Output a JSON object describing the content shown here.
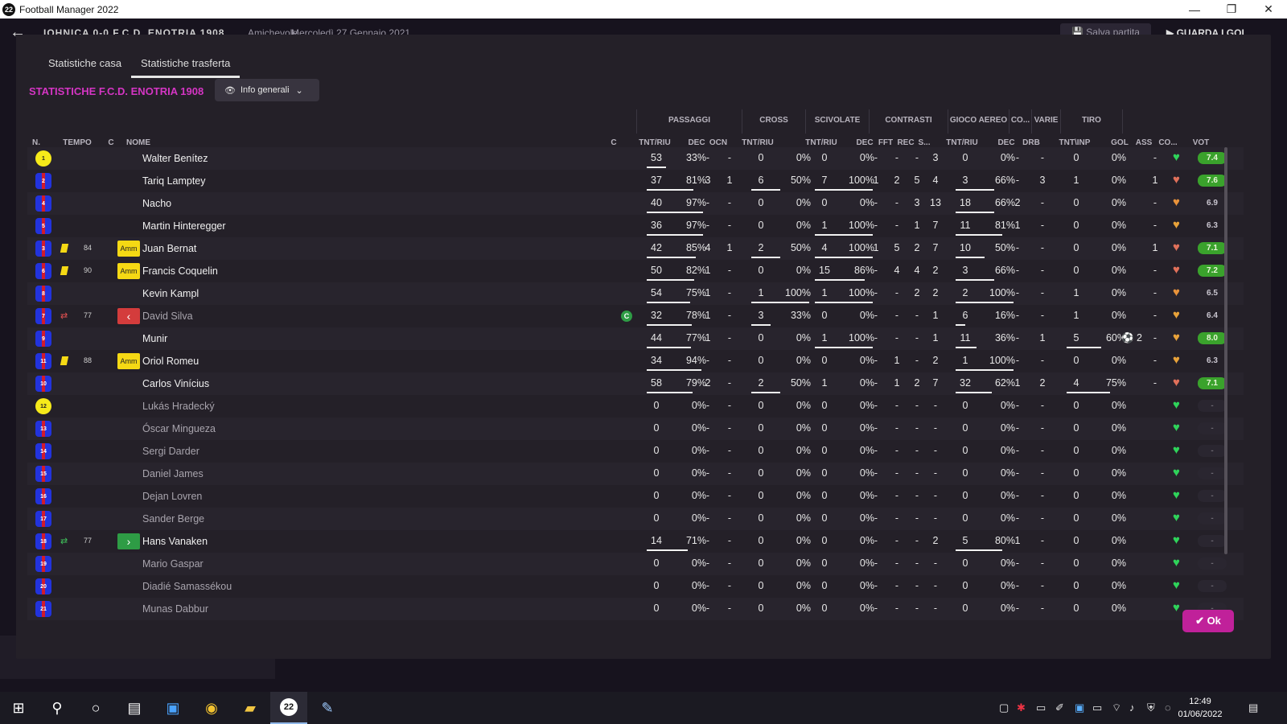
{
  "window": {
    "title": "Football Manager 2022",
    "app_icon": "22",
    "minimize": "—",
    "maximize": "❐",
    "close": "✕"
  },
  "bg_header": {
    "match_title": "IOHNICA 0-0 F.C.D. ENOTRIA 1908",
    "competition": "Amichevole",
    "date": "Mercoledì 27 Gennaio 2021",
    "save_label": "Salva partita",
    "continue_label": "GUARDA I GOL"
  },
  "tabs": [
    {
      "label": "Statistiche casa"
    },
    {
      "label": "Statistiche trasferta"
    }
  ],
  "team_title": "STATISTICHE F.C.D. ENOTRIA 1908",
  "view_dropdown": {
    "label": "Info generali"
  },
  "groups": {
    "passaggi": "PASSAGGI",
    "cross": "CROSS",
    "scivolate": "SCIVOLATE",
    "contrasti": "CONTRASTI",
    "gioco_aereo": "GIOCO AEREO",
    "co": "CO...",
    "varie": "VARIE",
    "tiro": "TIRO"
  },
  "columns": {
    "n": "N.",
    "tempo": "TEMPO",
    "c1": "C",
    "nome": "NOME",
    "c2": "C",
    "pass_tr": "TNT/RIU",
    "pass_dec": "DEC",
    "pass_ocn": "OCN",
    "cross_tr": "TNT/RIU",
    "sciv_tr": "TNT/RIU",
    "con_dec": "DEC",
    "con_fft": "FFT",
    "con_rec": "REC",
    "con_s": "S...",
    "aer_tr": "TNT/RIU",
    "co_dec": "DEC",
    "drb": "DRB",
    "tiro_tr": "TNT\\INP",
    "gol": "GOL",
    "ass": "ASS",
    "cond": "CO...",
    "vot": "VOT"
  },
  "players": [
    {
      "num": "1",
      "gk": true,
      "name": "Walter Benítez",
      "played": true,
      "pass_t": "53",
      "pass_p": "33%",
      "pass_f": 0.33,
      "dec": "-",
      "ocn": "-",
      "cross_t": "0",
      "cross_p": "0%",
      "cross_f": 0,
      "sciv_t": "0",
      "sciv_p": "0%",
      "sciv_f": 0,
      "cdec": "-",
      "fft": "-",
      "rec": "-",
      "s": "3",
      "aer_t": "0",
      "aer_p": "0%",
      "aer_f": 0,
      "codec": "-",
      "drb": "-",
      "tiro_t": "0",
      "tiro_p": "0%",
      "tiro_f": 0,
      "gol": "",
      "ass": "-",
      "heart": "#2fd35a",
      "vot": "7.4",
      "vot_style": "good"
    },
    {
      "num": "2",
      "name": "Tariq Lamptey",
      "played": true,
      "pass_t": "37",
      "pass_p": "81%",
      "pass_f": 0.81,
      "dec": "3",
      "ocn": "1",
      "cross_t": "6",
      "cross_p": "50%",
      "cross_f": 0.5,
      "sciv_t": "7",
      "sciv_p": "100%",
      "sciv_f": 1,
      "cdec": "1",
      "fft": "2",
      "rec": "5",
      "s": "4",
      "aer_t": "3",
      "aer_p": "66%",
      "aer_f": 0.66,
      "codec": "-",
      "drb": "3",
      "tiro_t": "1",
      "tiro_p": "0%",
      "tiro_f": 0,
      "gol": "",
      "ass": "1",
      "heart": "#e0705a",
      "vot": "7.6",
      "vot_style": "good"
    },
    {
      "num": "4",
      "name": "Nacho",
      "played": true,
      "pass_t": "40",
      "pass_p": "97%",
      "pass_f": 0.97,
      "dec": "-",
      "ocn": "-",
      "cross_t": "0",
      "cross_p": "0%",
      "cross_f": 0,
      "sciv_t": "0",
      "sciv_p": "0%",
      "sciv_f": 0,
      "cdec": "-",
      "fft": "-",
      "rec": "3",
      "s": "13",
      "aer_t": "18",
      "aer_p": "66%",
      "aer_f": 0.66,
      "codec": "2",
      "drb": "-",
      "tiro_t": "0",
      "tiro_p": "0%",
      "tiro_f": 0,
      "gol": "",
      "ass": "-",
      "heart": "#e8923a",
      "vot": "6.9",
      "vot_style": "plain"
    },
    {
      "num": "5",
      "name": "Martin Hinteregger",
      "played": true,
      "pass_t": "36",
      "pass_p": "97%",
      "pass_f": 0.97,
      "dec": "-",
      "ocn": "-",
      "cross_t": "0",
      "cross_p": "0%",
      "cross_f": 0,
      "sciv_t": "1",
      "sciv_p": "100%",
      "sciv_f": 1,
      "cdec": "-",
      "fft": "-",
      "rec": "1",
      "s": "7",
      "aer_t": "11",
      "aer_p": "81%",
      "aer_f": 0.81,
      "codec": "1",
      "drb": "-",
      "tiro_t": "0",
      "tiro_p": "0%",
      "tiro_f": 0,
      "gol": "",
      "ass": "-",
      "heart": "#e8a23a",
      "vot": "6.3",
      "vot_style": "plain"
    },
    {
      "num": "3",
      "card": true,
      "minute": "84",
      "badge": "amm",
      "badge_text": "Amm",
      "name": "Juan Bernat",
      "played": true,
      "pass_t": "42",
      "pass_p": "85%",
      "pass_f": 0.85,
      "dec": "4",
      "ocn": "1",
      "cross_t": "2",
      "cross_p": "50%",
      "cross_f": 0.5,
      "sciv_t": "4",
      "sciv_p": "100%",
      "sciv_f": 1,
      "cdec": "1",
      "fft": "5",
      "rec": "2",
      "s": "7",
      "aer_t": "10",
      "aer_p": "50%",
      "aer_f": 0.5,
      "codec": "-",
      "drb": "-",
      "tiro_t": "0",
      "tiro_p": "0%",
      "tiro_f": 0,
      "gol": "",
      "ass": "1",
      "heart": "#e0705a",
      "vot": "7.1",
      "vot_style": "good"
    },
    {
      "num": "6",
      "card": true,
      "minute": "90",
      "badge": "amm",
      "badge_text": "Amm",
      "name": "Francis Coquelin",
      "played": true,
      "pass_t": "50",
      "pass_p": "82%",
      "pass_f": 0.82,
      "dec": "1",
      "ocn": "-",
      "cross_t": "0",
      "cross_p": "0%",
      "cross_f": 0,
      "sciv_t": "15",
      "sciv_p": "86%",
      "sciv_f": 0.86,
      "cdec": "-",
      "fft": "4",
      "rec": "4",
      "s": "2",
      "aer_t": "3",
      "aer_p": "66%",
      "aer_f": 0.66,
      "codec": "-",
      "drb": "-",
      "tiro_t": "0",
      "tiro_p": "0%",
      "tiro_f": 0,
      "gol": "",
      "ass": "-",
      "heart": "#e0705a",
      "vot": "7.2",
      "vot_style": "good"
    },
    {
      "num": "8",
      "name": "Kevin Kampl",
      "played": true,
      "pass_t": "54",
      "pass_p": "75%",
      "pass_f": 0.75,
      "dec": "1",
      "ocn": "-",
      "cross_t": "1",
      "cross_p": "100%",
      "cross_f": 1,
      "sciv_t": "1",
      "sciv_p": "100%",
      "sciv_f": 1,
      "cdec": "-",
      "fft": "-",
      "rec": "2",
      "s": "2",
      "aer_t": "2",
      "aer_p": "100%",
      "aer_f": 1,
      "codec": "-",
      "drb": "-",
      "tiro_t": "1",
      "tiro_p": "0%",
      "tiro_f": 0,
      "gol": "",
      "ass": "-",
      "heart": "#e8923a",
      "vot": "6.5",
      "vot_style": "plain"
    },
    {
      "num": "7",
      "sub": "out",
      "minute": "77",
      "badge": "out",
      "badge_text": "‹",
      "name": "David Silva",
      "played": false,
      "captain": "C",
      "pass_t": "32",
      "pass_p": "78%",
      "pass_f": 0.78,
      "dec": "1",
      "ocn": "-",
      "cross_t": "3",
      "cross_p": "33%",
      "cross_f": 0.33,
      "sciv_t": "0",
      "sciv_p": "0%",
      "sciv_f": 0,
      "cdec": "-",
      "fft": "-",
      "rec": "-",
      "s": "1",
      "aer_t": "6",
      "aer_p": "16%",
      "aer_f": 0.16,
      "codec": "-",
      "drb": "-",
      "tiro_t": "1",
      "tiro_p": "0%",
      "tiro_f": 0,
      "gol": "",
      "ass": "-",
      "heart": "#e8a23a",
      "vot": "6.4",
      "vot_style": "plain"
    },
    {
      "num": "9",
      "name": "Munir",
      "played": true,
      "pass_t": "44",
      "pass_p": "77%",
      "pass_f": 0.77,
      "dec": "1",
      "ocn": "-",
      "cross_t": "0",
      "cross_p": "0%",
      "cross_f": 0,
      "sciv_t": "1",
      "sciv_p": "100%",
      "sciv_f": 1,
      "cdec": "-",
      "fft": "-",
      "rec": "-",
      "s": "1",
      "aer_t": "11",
      "aer_p": "36%",
      "aer_f": 0.36,
      "codec": "-",
      "drb": "1",
      "tiro_t": "5",
      "tiro_p": "60%",
      "tiro_f": 0.6,
      "gol": "2",
      "ass": "-",
      "heart": "#e8a23a",
      "vot": "8.0",
      "vot_style": "good"
    },
    {
      "num": "11",
      "card": true,
      "minute": "88",
      "badge": "amm",
      "badge_text": "Amm",
      "name": "Oriol Romeu",
      "played": true,
      "pass_t": "34",
      "pass_p": "94%",
      "pass_f": 0.94,
      "dec": "-",
      "ocn": "-",
      "cross_t": "0",
      "cross_p": "0%",
      "cross_f": 0,
      "sciv_t": "0",
      "sciv_p": "0%",
      "sciv_f": 0,
      "cdec": "-",
      "fft": "1",
      "rec": "-",
      "s": "2",
      "aer_t": "1",
      "aer_p": "100%",
      "aer_f": 1,
      "codec": "-",
      "drb": "-",
      "tiro_t": "0",
      "tiro_p": "0%",
      "tiro_f": 0,
      "gol": "",
      "ass": "-",
      "heart": "#e8a23a",
      "vot": "6.3",
      "vot_style": "plain"
    },
    {
      "num": "10",
      "name": "Carlos Vinícius",
      "played": true,
      "pass_t": "58",
      "pass_p": "79%",
      "pass_f": 0.79,
      "dec": "2",
      "ocn": "-",
      "cross_t": "2",
      "cross_p": "50%",
      "cross_f": 0.5,
      "sciv_t": "1",
      "sciv_p": "0%",
      "sciv_f": 0,
      "cdec": "-",
      "fft": "1",
      "rec": "2",
      "s": "7",
      "aer_t": "32",
      "aer_p": "62%",
      "aer_f": 0.62,
      "codec": "1",
      "drb": "2",
      "tiro_t": "4",
      "tiro_p": "75%",
      "tiro_f": 0.75,
      "gol": "",
      "ass": "-",
      "heart": "#e0705a",
      "vot": "7.1",
      "vot_style": "good"
    },
    {
      "num": "12",
      "gk": true,
      "name": "Lukás Hradecký",
      "played": false,
      "pass_t": "0",
      "pass_p": "0%",
      "pass_f": 0,
      "dec": "-",
      "ocn": "-",
      "cross_t": "0",
      "cross_p": "0%",
      "cross_f": 0,
      "sciv_t": "0",
      "sciv_p": "0%",
      "sciv_f": 0,
      "cdec": "-",
      "fft": "-",
      "rec": "-",
      "s": "-",
      "aer_t": "0",
      "aer_p": "0%",
      "aer_f": 0,
      "codec": "-",
      "drb": "-",
      "tiro_t": "0",
      "tiro_p": "0%",
      "tiro_f": 0,
      "gol": "",
      "ass": "",
      "heart": "#2fd35a",
      "vot": "-",
      "vot_style": "none"
    },
    {
      "num": "13",
      "name": "Óscar Mingueza",
      "played": false,
      "pass_t": "0",
      "pass_p": "0%",
      "pass_f": 0,
      "dec": "-",
      "ocn": "-",
      "cross_t": "0",
      "cross_p": "0%",
      "cross_f": 0,
      "sciv_t": "0",
      "sciv_p": "0%",
      "sciv_f": 0,
      "cdec": "-",
      "fft": "-",
      "rec": "-",
      "s": "-",
      "aer_t": "0",
      "aer_p": "0%",
      "aer_f": 0,
      "codec": "-",
      "drb": "-",
      "tiro_t": "0",
      "tiro_p": "0%",
      "tiro_f": 0,
      "gol": "",
      "ass": "",
      "heart": "#2fd35a",
      "vot": "-",
      "vot_style": "none"
    },
    {
      "num": "14",
      "name": "Sergi Darder",
      "played": false,
      "pass_t": "0",
      "pass_p": "0%",
      "pass_f": 0,
      "dec": "-",
      "ocn": "-",
      "cross_t": "0",
      "cross_p": "0%",
      "cross_f": 0,
      "sciv_t": "0",
      "sciv_p": "0%",
      "sciv_f": 0,
      "cdec": "-",
      "fft": "-",
      "rec": "-",
      "s": "-",
      "aer_t": "0",
      "aer_p": "0%",
      "aer_f": 0,
      "codec": "-",
      "drb": "-",
      "tiro_t": "0",
      "tiro_p": "0%",
      "tiro_f": 0,
      "gol": "",
      "ass": "",
      "heart": "#2fd35a",
      "vot": "-",
      "vot_style": "none"
    },
    {
      "num": "15",
      "name": "Daniel James",
      "played": false,
      "pass_t": "0",
      "pass_p": "0%",
      "pass_f": 0,
      "dec": "-",
      "ocn": "-",
      "cross_t": "0",
      "cross_p": "0%",
      "cross_f": 0,
      "sciv_t": "0",
      "sciv_p": "0%",
      "sciv_f": 0,
      "cdec": "-",
      "fft": "-",
      "rec": "-",
      "s": "-",
      "aer_t": "0",
      "aer_p": "0%",
      "aer_f": 0,
      "codec": "-",
      "drb": "-",
      "tiro_t": "0",
      "tiro_p": "0%",
      "tiro_f": 0,
      "gol": "",
      "ass": "",
      "heart": "#2fd35a",
      "vot": "-",
      "vot_style": "none"
    },
    {
      "num": "16",
      "name": "Dejan Lovren",
      "played": false,
      "pass_t": "0",
      "pass_p": "0%",
      "pass_f": 0,
      "dec": "-",
      "ocn": "-",
      "cross_t": "0",
      "cross_p": "0%",
      "cross_f": 0,
      "sciv_t": "0",
      "sciv_p": "0%",
      "sciv_f": 0,
      "cdec": "-",
      "fft": "-",
      "rec": "-",
      "s": "-",
      "aer_t": "0",
      "aer_p": "0%",
      "aer_f": 0,
      "codec": "-",
      "drb": "-",
      "tiro_t": "0",
      "tiro_p": "0%",
      "tiro_f": 0,
      "gol": "",
      "ass": "",
      "heart": "#2fd35a",
      "vot": "-",
      "vot_style": "none"
    },
    {
      "num": "17",
      "name": "Sander Berge",
      "played": false,
      "pass_t": "0",
      "pass_p": "0%",
      "pass_f": 0,
      "dec": "-",
      "ocn": "-",
      "cross_t": "0",
      "cross_p": "0%",
      "cross_f": 0,
      "sciv_t": "0",
      "sciv_p": "0%",
      "sciv_f": 0,
      "cdec": "-",
      "fft": "-",
      "rec": "-",
      "s": "-",
      "aer_t": "0",
      "aer_p": "0%",
      "aer_f": 0,
      "codec": "-",
      "drb": "-",
      "tiro_t": "0",
      "tiro_p": "0%",
      "tiro_f": 0,
      "gol": "",
      "ass": "",
      "heart": "#2fd35a",
      "vot": "-",
      "vot_style": "none"
    },
    {
      "num": "18",
      "sub": "in",
      "minute": "77",
      "badge": "in",
      "badge_text": "›",
      "name": "Hans Vanaken",
      "played": true,
      "pass_t": "14",
      "pass_p": "71%",
      "pass_f": 0.71,
      "dec": "-",
      "ocn": "-",
      "cross_t": "0",
      "cross_p": "0%",
      "cross_f": 0,
      "sciv_t": "0",
      "sciv_p": "0%",
      "sciv_f": 0,
      "cdec": "-",
      "fft": "-",
      "rec": "-",
      "s": "2",
      "aer_t": "5",
      "aer_p": "80%",
      "aer_f": 0.8,
      "codec": "1",
      "drb": "-",
      "tiro_t": "0",
      "tiro_p": "0%",
      "tiro_f": 0,
      "gol": "",
      "ass": "",
      "heart": "#2fd35a",
      "vot": "-",
      "vot_style": "none"
    },
    {
      "num": "19",
      "name": "Mario Gaspar",
      "played": false,
      "pass_t": "0",
      "pass_p": "0%",
      "pass_f": 0,
      "dec": "-",
      "ocn": "-",
      "cross_t": "0",
      "cross_p": "0%",
      "cross_f": 0,
      "sciv_t": "0",
      "sciv_p": "0%",
      "sciv_f": 0,
      "cdec": "-",
      "fft": "-",
      "rec": "-",
      "s": "-",
      "aer_t": "0",
      "aer_p": "0%",
      "aer_f": 0,
      "codec": "-",
      "drb": "-",
      "tiro_t": "0",
      "tiro_p": "0%",
      "tiro_f": 0,
      "gol": "",
      "ass": "",
      "heart": "#2fd35a",
      "vot": "-",
      "vot_style": "none"
    },
    {
      "num": "20",
      "name": "Diadié Samassékou",
      "played": false,
      "pass_t": "0",
      "pass_p": "0%",
      "pass_f": 0,
      "dec": "-",
      "ocn": "-",
      "cross_t": "0",
      "cross_p": "0%",
      "cross_f": 0,
      "sciv_t": "0",
      "sciv_p": "0%",
      "sciv_f": 0,
      "cdec": "-",
      "fft": "-",
      "rec": "-",
      "s": "-",
      "aer_t": "0",
      "aer_p": "0%",
      "aer_f": 0,
      "codec": "-",
      "drb": "-",
      "tiro_t": "0",
      "tiro_p": "0%",
      "tiro_f": 0,
      "gol": "",
      "ass": "",
      "heart": "#2fd35a",
      "vot": "-",
      "vot_style": "none"
    },
    {
      "num": "21",
      "name": "Munas Dabbur",
      "played": false,
      "pass_t": "0",
      "pass_p": "0%",
      "pass_f": 0,
      "dec": "-",
      "ocn": "-",
      "cross_t": "0",
      "cross_p": "0%",
      "cross_f": 0,
      "sciv_t": "0",
      "sciv_p": "0%",
      "sciv_f": 0,
      "cdec": "-",
      "fft": "-",
      "rec": "-",
      "s": "-",
      "aer_t": "0",
      "aer_p": "0%",
      "aer_f": 0,
      "codec": "-",
      "drb": "-",
      "tiro_t": "0",
      "tiro_p": "0%",
      "tiro_f": 0,
      "gol": "",
      "ass": "",
      "heart": "#2fd35a",
      "vot": "-",
      "vot_style": "none"
    }
  ],
  "ok_button": {
    "label": "✔ Ok"
  },
  "taskbar": {
    "time": "12:49",
    "date": "01/06/2022",
    "fm_icon": "22"
  }
}
